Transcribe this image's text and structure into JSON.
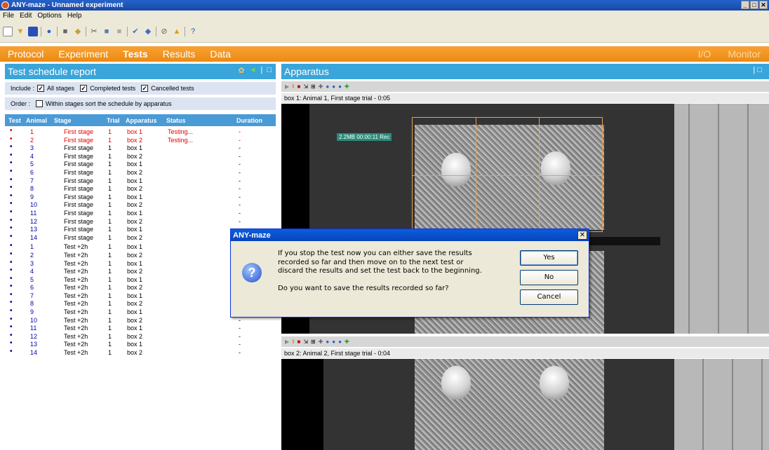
{
  "window": {
    "title": "ANY-maze - Unnamed experiment",
    "controls": [
      "_",
      "□",
      "✕"
    ]
  },
  "menu": [
    "File",
    "Edit",
    "Options",
    "Help"
  ],
  "nav": {
    "tabs": [
      "Protocol",
      "Experiment",
      "Tests",
      "Results",
      "Data"
    ],
    "active": "Tests",
    "right": [
      "I/O",
      "Monitor"
    ]
  },
  "left_panel": {
    "title": "Test schedule report",
    "include_label": "Include :",
    "include_options": [
      "All stages",
      "Completed tests",
      "Cancelled tests"
    ],
    "order_label": "Order :",
    "order_option": "Within stages sort the schedule by apparatus",
    "columns": [
      "Test",
      "Animal",
      "Stage",
      "Trial",
      "Apparatus",
      "Status",
      "Duration"
    ],
    "rows": [
      {
        "a": "1",
        "s": "First stage",
        "t": "1",
        "ap": "box 1",
        "st": "Testing...",
        "d": "-",
        "testing": true
      },
      {
        "a": "2",
        "s": "First stage",
        "t": "1",
        "ap": "box 2",
        "st": "Testing...",
        "d": "-",
        "testing": true
      },
      {
        "a": "3",
        "s": "First stage",
        "t": "1",
        "ap": "box 1",
        "st": "",
        "d": "-"
      },
      {
        "a": "4",
        "s": "First stage",
        "t": "1",
        "ap": "box 2",
        "st": "",
        "d": "-"
      },
      {
        "a": "5",
        "s": "First stage",
        "t": "1",
        "ap": "box 1",
        "st": "",
        "d": "-"
      },
      {
        "a": "6",
        "s": "First stage",
        "t": "1",
        "ap": "box 2",
        "st": "",
        "d": "-"
      },
      {
        "a": "7",
        "s": "First stage",
        "t": "1",
        "ap": "box 1",
        "st": "",
        "d": "-"
      },
      {
        "a": "8",
        "s": "First stage",
        "t": "1",
        "ap": "box 2",
        "st": "",
        "d": "-"
      },
      {
        "a": "9",
        "s": "First stage",
        "t": "1",
        "ap": "box 1",
        "st": "",
        "d": "-"
      },
      {
        "a": "10",
        "s": "First stage",
        "t": "1",
        "ap": "box 2",
        "st": "",
        "d": "-"
      },
      {
        "a": "11",
        "s": "First stage",
        "t": "1",
        "ap": "box 1",
        "st": "",
        "d": "-"
      },
      {
        "a": "12",
        "s": "First stage",
        "t": "1",
        "ap": "box 2",
        "st": "",
        "d": "-"
      },
      {
        "a": "13",
        "s": "First stage",
        "t": "1",
        "ap": "box 1",
        "st": "",
        "d": "-"
      },
      {
        "a": "14",
        "s": "First stage",
        "t": "1",
        "ap": "box 2",
        "st": "",
        "d": "-"
      },
      {
        "a": "1",
        "s": "Test +2h",
        "t": "1",
        "ap": "box 1",
        "st": "",
        "d": "",
        "gap": true
      },
      {
        "a": "2",
        "s": "Test +2h",
        "t": "1",
        "ap": "box 2",
        "st": "",
        "d": ""
      },
      {
        "a": "3",
        "s": "Test +2h",
        "t": "1",
        "ap": "box 1",
        "st": "",
        "d": ""
      },
      {
        "a": "4",
        "s": "Test +2h",
        "t": "1",
        "ap": "box 2",
        "st": "",
        "d": ""
      },
      {
        "a": "5",
        "s": "Test +2h",
        "t": "1",
        "ap": "box 1",
        "st": "",
        "d": ""
      },
      {
        "a": "6",
        "s": "Test +2h",
        "t": "1",
        "ap": "box 2",
        "st": "",
        "d": ""
      },
      {
        "a": "7",
        "s": "Test +2h",
        "t": "1",
        "ap": "box 1",
        "st": "",
        "d": "-"
      },
      {
        "a": "8",
        "s": "Test +2h",
        "t": "1",
        "ap": "box 2",
        "st": "",
        "d": "-"
      },
      {
        "a": "9",
        "s": "Test +2h",
        "t": "1",
        "ap": "box 1",
        "st": "",
        "d": "-"
      },
      {
        "a": "10",
        "s": "Test +2h",
        "t": "1",
        "ap": "box 2",
        "st": "",
        "d": "-"
      },
      {
        "a": "11",
        "s": "Test +2h",
        "t": "1",
        "ap": "box 1",
        "st": "",
        "d": "-"
      },
      {
        "a": "12",
        "s": "Test +2h",
        "t": "1",
        "ap": "box 2",
        "st": "",
        "d": "-"
      },
      {
        "a": "13",
        "s": "Test +2h",
        "t": "1",
        "ap": "box 1",
        "st": "",
        "d": "-"
      },
      {
        "a": "14",
        "s": "Test +2h",
        "t": "1",
        "ap": "box 2",
        "st": "",
        "d": "-"
      }
    ]
  },
  "right_panel": {
    "title": "Apparatus",
    "box1_label": "box 1: Animal 1, First stage trial - 0:05",
    "box1_overlay": "2.2MB 00:00:11 Rec",
    "box2_label": "box 2: Animal 2, First stage trial - 0:04"
  },
  "dialog": {
    "title": "ANY-maze",
    "close": "✕",
    "line1": "If you stop the test now you can either save the results",
    "line2": "recorded so far and then move on to the next test or",
    "line3": "discard the results and set the test back to the beginning.",
    "question": "Do you want to save the results recorded so far?",
    "yes": "Yes",
    "no": "No",
    "cancel": "Cancel"
  },
  "colors": {
    "nav": "#f39a22",
    "panel_header": "#3aa5da",
    "testing": "#e00000",
    "table_header": "#4a9ad6"
  }
}
